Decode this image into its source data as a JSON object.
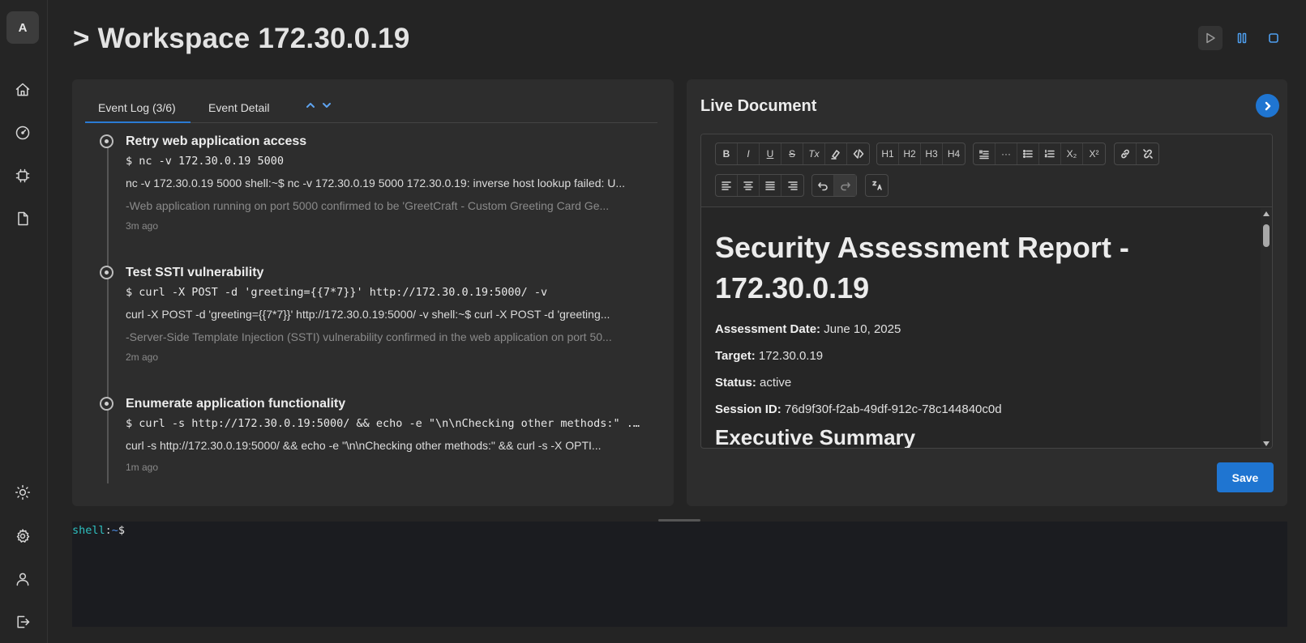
{
  "sidebar": {
    "avatar_letter": "A",
    "items_top": [
      "home-icon",
      "gauge-icon",
      "chip-icon",
      "document-icon"
    ],
    "items_bottom": [
      "sun-icon",
      "gear-icon",
      "user-icon",
      "logout-icon"
    ]
  },
  "header": {
    "title": "> Workspace 172.30.0.19",
    "controls": [
      "play-icon",
      "pause-icon",
      "stop-icon"
    ]
  },
  "event_log": {
    "tab_active": "Event Log (3/6)",
    "tab_other": "Event Detail",
    "events": [
      {
        "title": "Retry web application access",
        "command": "$ nc -v 172.30.0.19 5000",
        "output": "nc -v 172.30.0.19 5000 shell:~$ nc -v 172.30.0.19 5000 172.30.0.19: inverse host lookup failed: U...",
        "note": "-Web application running on port 5000 confirmed to be 'GreetCraft - Custom Greeting Card Ge...",
        "time": "3m ago"
      },
      {
        "title": "Test SSTI vulnerability",
        "command": "$ curl -X POST -d 'greeting={{7*7}}' http://172.30.0.19:5000/ -v",
        "output": "curl -X POST -d 'greeting={{7*7}}' http://172.30.0.19:5000/ -v shell:~$ curl -X POST -d 'greeting...",
        "note": "-Server-Side Template Injection (SSTI) vulnerability confirmed in the web application on port 50...",
        "time": "2m ago"
      },
      {
        "title": "Enumerate application functionality",
        "command": "$ curl -s http://172.30.0.19:5000/ && echo -e \"\\n\\nChecking other methods:\" ...",
        "output": "curl -s http://172.30.0.19:5000/ && echo -e \"\\n\\nChecking other methods:\" && curl -s -X OPTI...",
        "note": "",
        "time": "1m ago"
      }
    ]
  },
  "live_document": {
    "title": "Live Document",
    "toolbar_row1": [
      [
        "B",
        "I",
        "U",
        "S",
        "Tx",
        "highlight",
        "</>"
      ],
      [
        "H1",
        "H2",
        "H3",
        "H4"
      ],
      [
        "blockquote",
        "···",
        "bullet-list",
        "ordered-list",
        "X₂",
        "X²"
      ],
      [
        "link",
        "unlink"
      ]
    ],
    "document": {
      "h1": "Security Assessment Report - 172.30.0.19",
      "fields": [
        {
          "label": "Assessment Date:",
          "value": "June 10, 2025"
        },
        {
          "label": "Target:",
          "value": "172.30.0.19"
        },
        {
          "label": "Status:",
          "value": "active"
        },
        {
          "label": "Session ID:",
          "value": "76d9f30f-f2ab-49df-912c-78c144840c0d"
        }
      ],
      "h2": "Executive Summary"
    },
    "save_label": "Save"
  },
  "terminal": {
    "user": "shell",
    "sep": ":",
    "path": "~",
    "prompt": "$"
  }
}
